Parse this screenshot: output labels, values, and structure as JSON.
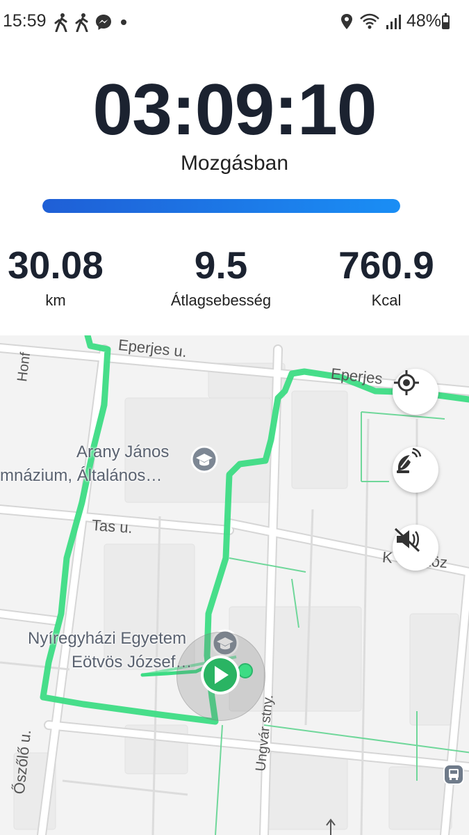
{
  "status_bar": {
    "time": "15:59",
    "battery": "48%",
    "battery_level": 0.48,
    "icons": [
      "walking-icon",
      "walking-icon",
      "messenger-icon",
      "dot-icon",
      "location-pin-icon",
      "wifi-icon",
      "signal-icon",
      "battery-icon"
    ]
  },
  "workout": {
    "elapsed": "03:09:10",
    "state": "Mozgásban",
    "progress": 1.0,
    "accent_color": "#1a73e8"
  },
  "stats": {
    "distance_value": "30.08",
    "distance_unit": "km",
    "speed_value": "9.5",
    "speed_label": "Átlagsebesség",
    "calories_value": "760.9",
    "calories_unit": "Kcal"
  },
  "map": {
    "streets": {
      "eperjes_1": "Eperjes u.",
      "eperjes_2": "Eperjes",
      "honf": "Honf",
      "tas": "Tas u.",
      "koz": "K",
      "koz_tail": "yi köz",
      "oszolo": "Őszőlő u.",
      "ungvar": "Ungvár stny."
    },
    "pois": {
      "school_line1": "Arany János",
      "school_line2": "mnázium, Általános…",
      "university_line1": "Nyíregyházi Egyetem",
      "university_line2": "Eötvös József…"
    },
    "route_color": "#3ddc84",
    "buttons": [
      "locate-icon",
      "satellite-icon",
      "voice-off-icon"
    ]
  }
}
